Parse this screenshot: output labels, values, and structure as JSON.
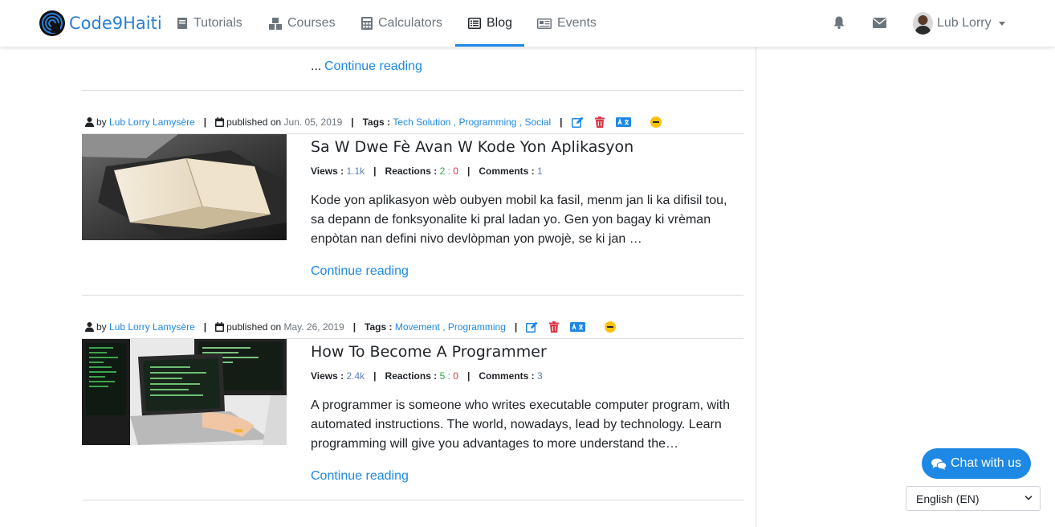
{
  "nav": {
    "brand": "Code9Haiti",
    "items": [
      {
        "label": "Tutorials",
        "icon": "book-icon"
      },
      {
        "label": "Courses",
        "icon": "cubes-icon"
      },
      {
        "label": "Calculators",
        "icon": "calculator-icon"
      },
      {
        "label": "Blog",
        "icon": "list-alt-icon",
        "active": true
      },
      {
        "label": "Events",
        "icon": "newspaper-icon"
      }
    ],
    "notifications_icon": "bell-icon",
    "messages_icon": "envelope-icon",
    "user_name": "Lub Lorry"
  },
  "top_post": {
    "ellipsis": "...",
    "continue": "Continue reading"
  },
  "posts": [
    {
      "by_prefix": "by",
      "author": "Lub Lorry Lamysère",
      "published_prefix": "published on",
      "date": "Jun. 05, 2019",
      "tags_label": "Tags :",
      "tags": "Tech Solution , Programming , Social",
      "sep": "|",
      "title": "Sa W Dwe Fè Avan W Kode Yon Aplikasyon",
      "views_label": "Views :",
      "views": "1.1k",
      "reactions_label": "Reactions :",
      "reactions_pos": "2",
      "reactions_colon": ":",
      "reactions_neg": "0",
      "comments_label": "Comments :",
      "comments": "1",
      "excerpt": "Kode yon aplikasyon wèb oubyen mobil ka fasil, menm jan li ka difisil tou, sa depann de fonksyonalite ki pral ladan yo. Gen yon bagay ki vrèman enpòtan nan defini nivo devlòpman yon pwojè, se ki jan …",
      "continue": "Continue reading"
    },
    {
      "by_prefix": "by",
      "author": "Lub Lorry Lamysère",
      "published_prefix": "published on",
      "date": "May. 26, 2019",
      "tags_label": "Tags :",
      "tags": "Movement , Programming",
      "sep": "|",
      "title": "How To Become A Programmer",
      "views_label": "Views :",
      "views": "2.4k",
      "reactions_label": "Reactions :",
      "reactions_pos": "5",
      "reactions_colon": ":",
      "reactions_neg": "0",
      "comments_label": "Comments :",
      "comments": "3",
      "excerpt": "A programmer is someone who writes executable computer program, with automated instructions. The world, nowadays, lead by technology. Learn programming will give you advantages to more understand the…",
      "continue": "Continue reading"
    }
  ],
  "chat": {
    "label": "Chat with us"
  },
  "language": {
    "selected": "English (EN)"
  },
  "colors": {
    "accent": "#1e88e5",
    "delete": "#dc3545",
    "status": "#ffc107"
  }
}
